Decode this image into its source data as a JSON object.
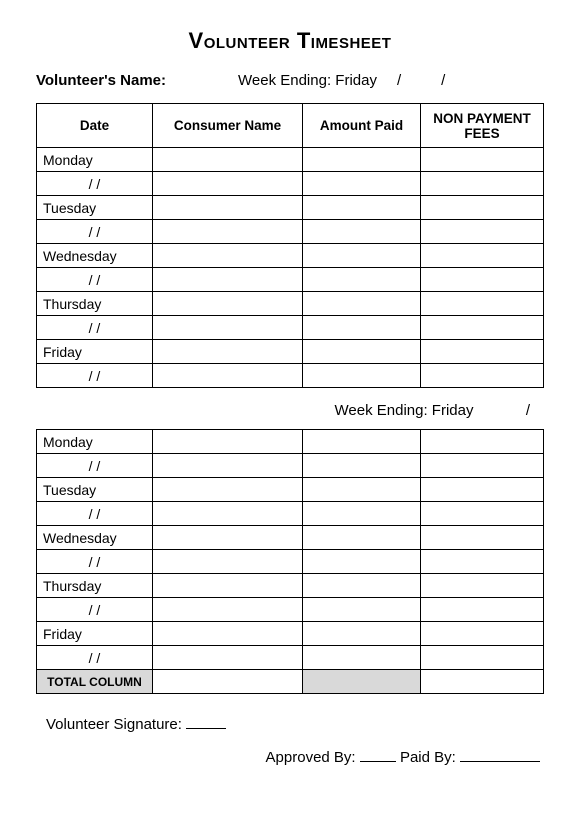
{
  "title": "Volunteer Timesheet",
  "labels": {
    "volunteer_name": "Volunteer's Name:",
    "week_ending_1": "Week Ending: Friday",
    "week_ending_2": "Week Ending: Friday",
    "slash": "/",
    "volunteer_signature": "Volunteer Signature:",
    "approved_by": "Approved By:",
    "paid_by": "Paid By:"
  },
  "headers": {
    "date": "Date",
    "consumer": "Consumer Name",
    "amount": "Amount Paid",
    "nonpayment": "NON PAYMENT FEES"
  },
  "days": [
    "Monday",
    "Tuesday",
    "Wednesday",
    "Thursday",
    "Friday"
  ],
  "date_placeholder": "/      /",
  "total_label": "TOTAL COLUMN"
}
